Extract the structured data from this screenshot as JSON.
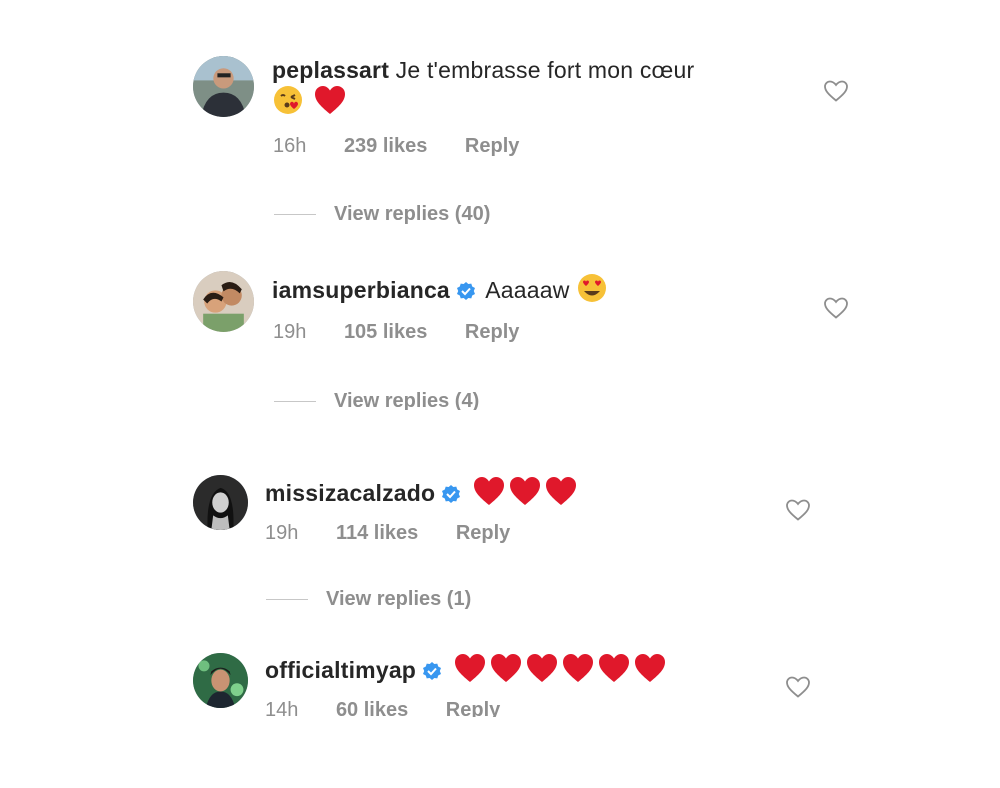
{
  "comments": [
    {
      "username": "peplassart",
      "verified": false,
      "text": "Je t'embrasse fort mon cœur",
      "emojis": [
        "kiss-face",
        "red-heart"
      ],
      "time": "16h",
      "likes": "239 likes",
      "reply": "Reply",
      "view_replies": "View replies (40)"
    },
    {
      "username": "iamsuperbianca",
      "verified": true,
      "text": "Aaaaaw",
      "emojis": [
        "heart-eyes-face"
      ],
      "time": "19h",
      "likes": "105 likes",
      "reply": "Reply",
      "view_replies": "View replies (4)"
    },
    {
      "username": "missizacalzado",
      "verified": true,
      "text": "",
      "emojis": [
        "red-heart",
        "red-heart",
        "red-heart"
      ],
      "time": "19h",
      "likes": "114 likes",
      "reply": "Reply",
      "view_replies": "View replies (1)"
    },
    {
      "username": "officialtimyap",
      "verified": true,
      "text": "",
      "emojis": [
        "red-heart",
        "red-heart",
        "red-heart",
        "red-heart",
        "red-heart",
        "red-heart"
      ],
      "time": "14h",
      "likes": "60 likes",
      "reply": "Reply"
    }
  ],
  "colors": {
    "text": "#262626",
    "meta": "#8e8e8e",
    "verified": "#3897f0",
    "heart": "#e0182b"
  }
}
